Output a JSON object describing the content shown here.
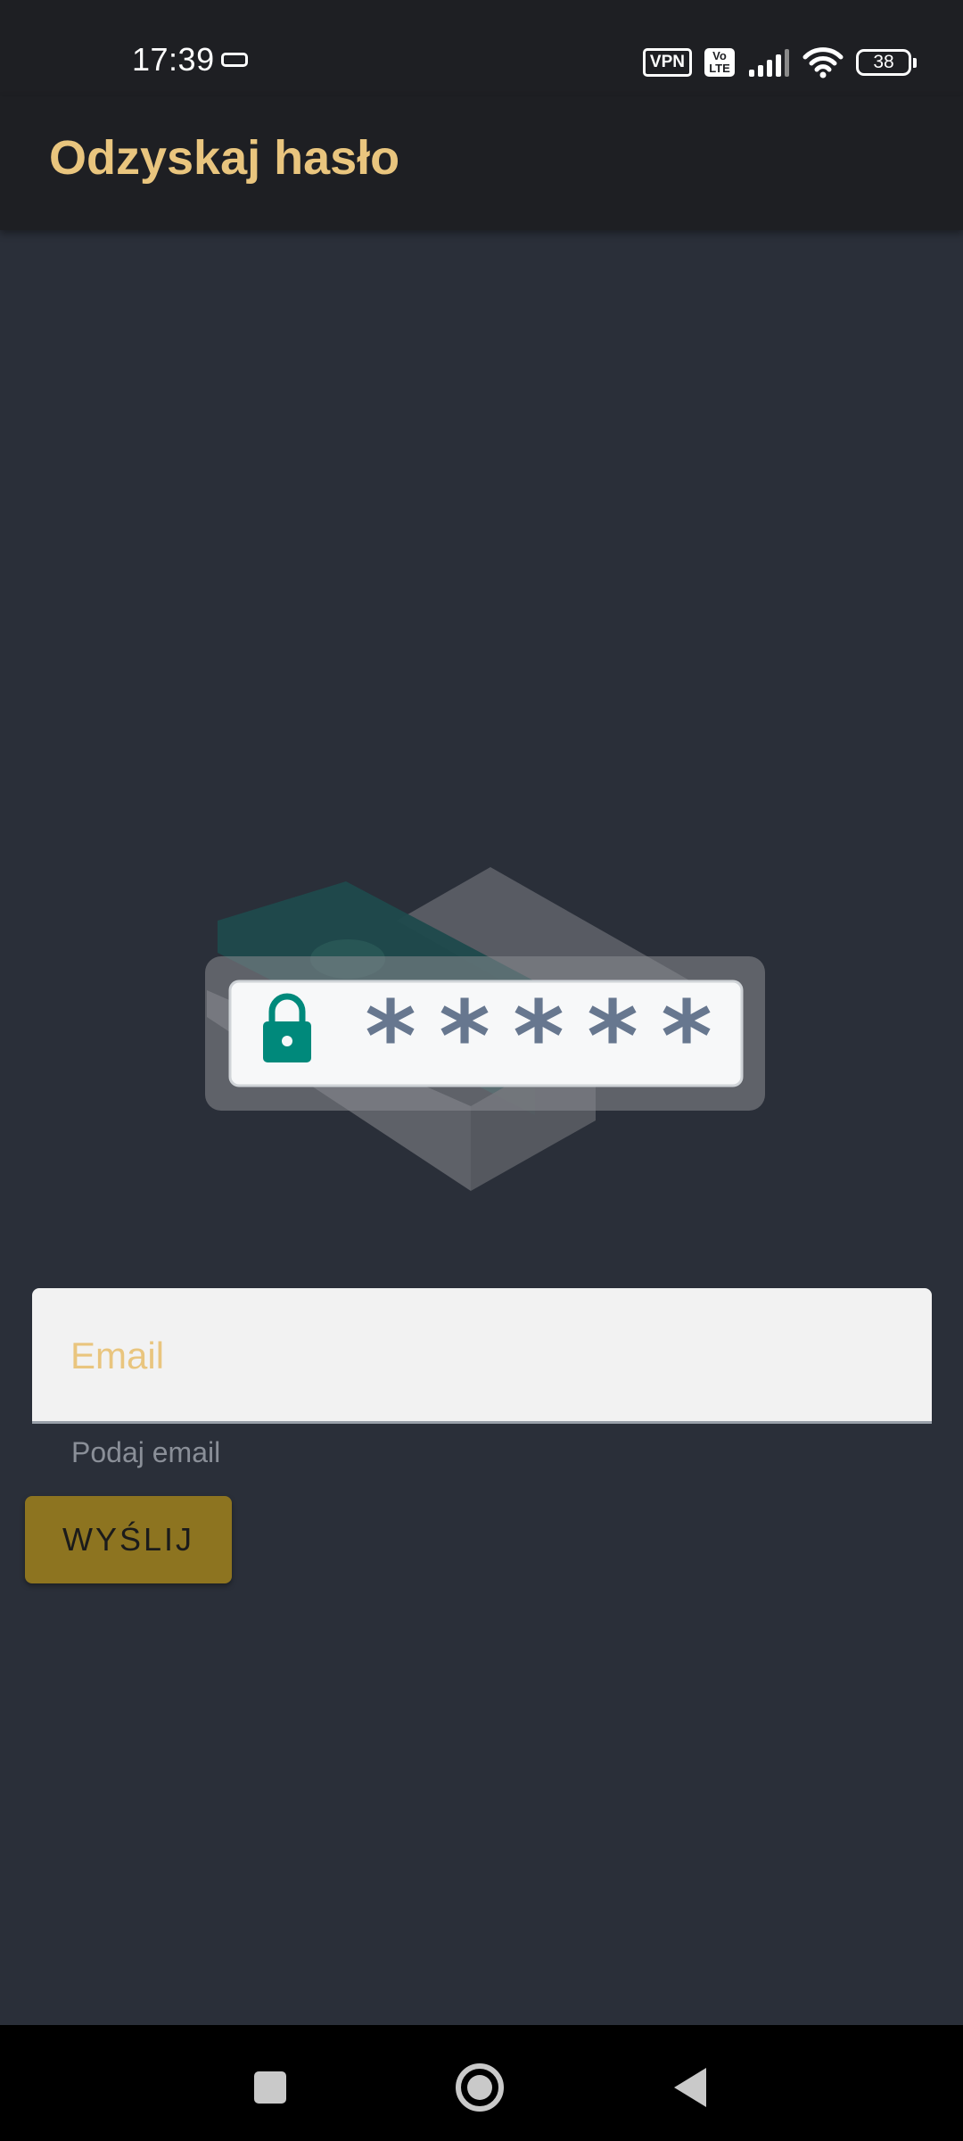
{
  "status_bar": {
    "time": "17:39",
    "vpn_badge": "VPN",
    "volte_badge_top": "Vo",
    "volte_badge_bottom": "LTE",
    "battery_level": "38",
    "icons": [
      "sim-icon",
      "vpn-icon",
      "volte-icon",
      "signal-icon",
      "wifi-icon",
      "battery-icon"
    ]
  },
  "app_bar": {
    "title": "Odzyskaj hasło"
  },
  "illustration": {
    "icons": [
      "lock-icon",
      "password-asterisks-icon"
    ],
    "mask": "*****",
    "accent_color": "#00897b",
    "asterisk_color": "#67778f"
  },
  "form": {
    "email_label": "Email",
    "email_helper": "Podaj email",
    "send_label": "WYŚLIJ"
  },
  "nav_bar": {
    "icons": [
      "recents-square-icon",
      "home-circle-icon",
      "back-triangle-icon"
    ]
  },
  "colors": {
    "background": "#2a2f39",
    "bars": "#1e1f23",
    "accent_text": "#e9c57e",
    "button": "#8d7420"
  }
}
